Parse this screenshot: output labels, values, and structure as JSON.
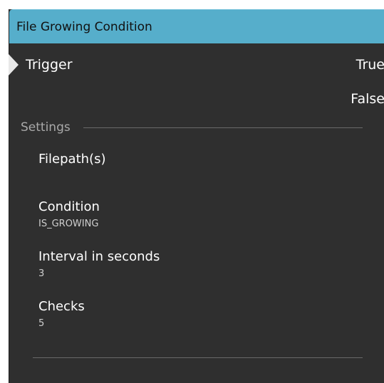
{
  "node": {
    "title": "File Growing Condition",
    "input_port": "Trigger",
    "output_ports": [
      "True",
      "False"
    ]
  },
  "settings": {
    "section_label": "Settings",
    "fields": [
      {
        "name": "Filepath(s)",
        "value": ""
      },
      {
        "name": "Condition",
        "value": "IS_GROWING"
      },
      {
        "name": "Interval in seconds",
        "value": "3"
      },
      {
        "name": "Checks",
        "value": "5"
      }
    ]
  },
  "colors": {
    "header": "#56aecb",
    "body": "#2f2f2f",
    "text": "#ffffff",
    "muted_text": "#a9a9a9"
  },
  "icons": {
    "input_port": "triangle-right-icon"
  }
}
